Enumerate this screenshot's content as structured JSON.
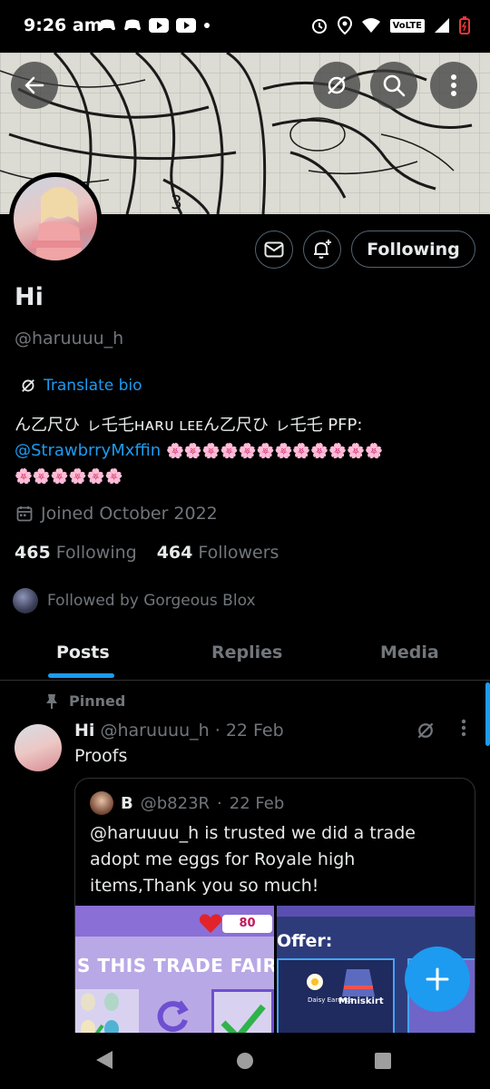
{
  "status_bar": {
    "time": "9:26 am",
    "network": "VoLTE"
  },
  "profile": {
    "name": "Hi",
    "handle": "@haruuuu_h",
    "following_button": "Following",
    "translate_label": "Translate bio",
    "bio_line1": "ん乙尺ひ ㇾ乇乇ʜᴀʀᴜ ʟᴇᴇん乙尺ひ ㇾ乇乇 PFP:",
    "bio_mention": "@StrawbrryMxffin",
    "bio_emoji1": "🌸🌸🌸🌸🌸🌸🌸🌸🌸🌸🌸🌸",
    "bio_emoji2": "🌸🌸🌸🌸🌸🌸",
    "joined": "Joined October 2022",
    "following_count": "465",
    "following_label": "Following",
    "followers_count": "464",
    "followers_label": "Followers",
    "followed_by": "Followed by Gorgeous Blox"
  },
  "tabs": [
    {
      "label": "Posts",
      "active": true
    },
    {
      "label": "Replies",
      "active": false
    },
    {
      "label": "Media",
      "active": false
    }
  ],
  "pinned_post": {
    "pinned_label": "Pinned",
    "author_name": "Hi",
    "author_handle": "@haruuuu_h",
    "date": "22 Feb",
    "text": "Proofs",
    "quote": {
      "author_name": "B",
      "author_handle": "@b823R",
      "date": "22 Feb",
      "text": "@haruuuu_h is trusted we did a trade adopt me eggs for Royale high items,Thank you so much!",
      "media_left_text": "S THIS TRADE FAIR?",
      "media_left_number": "80",
      "media_right_title": "Offer:",
      "media_right_item1": "Daisy Earrings",
      "media_right_item2": "Miniskirt"
    }
  },
  "colors": {
    "accent": "#1d9bf0",
    "background": "#000000",
    "muted_text": "#71767b",
    "border": "#2f3336"
  },
  "icons": {
    "back": "arrow-left-icon",
    "grok": "grok-icon",
    "search": "search-icon",
    "more": "more-vertical-icon",
    "message": "envelope-icon",
    "notify": "bell-plus-icon",
    "calendar": "calendar-icon",
    "pin": "pin-icon",
    "compose": "plus-icon"
  }
}
